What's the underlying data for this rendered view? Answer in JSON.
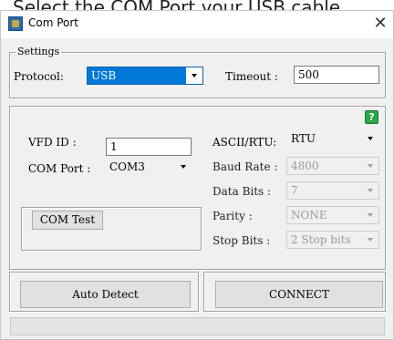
{
  "caption": "Select the COM Port your USB cable",
  "window": {
    "title": "Com Port",
    "close_glyph": "✕"
  },
  "settings": {
    "legend": "Settings",
    "protocol_label": "Protocol:",
    "protocol_value": "USB",
    "timeout_label": "Timeout :",
    "timeout_value": "500"
  },
  "left": {
    "vfd_label": "VFD ID :",
    "vfd_value": "1",
    "com_port_label": "COM Port :",
    "com_port_value": "COM3",
    "com_test_label": "COM Test"
  },
  "right": {
    "ascii_label": "ASCII/RTU:",
    "ascii_value": "RTU",
    "baud_label": "Baud Rate :",
    "baud_value": "4800",
    "data_bits_label": "Data Bits :",
    "data_bits_value": "7",
    "parity_label": "Parity :",
    "parity_value": "NONE",
    "stop_bits_label": "Stop Bits :",
    "stop_bits_value": "2 Stop bits"
  },
  "help_glyph": "?",
  "buttons": {
    "auto_detect": "Auto Detect",
    "connect": "CONNECT"
  },
  "colors": {
    "selection": "#0078d7",
    "help": "#28a745",
    "window_bg": "#f0f0f0"
  }
}
